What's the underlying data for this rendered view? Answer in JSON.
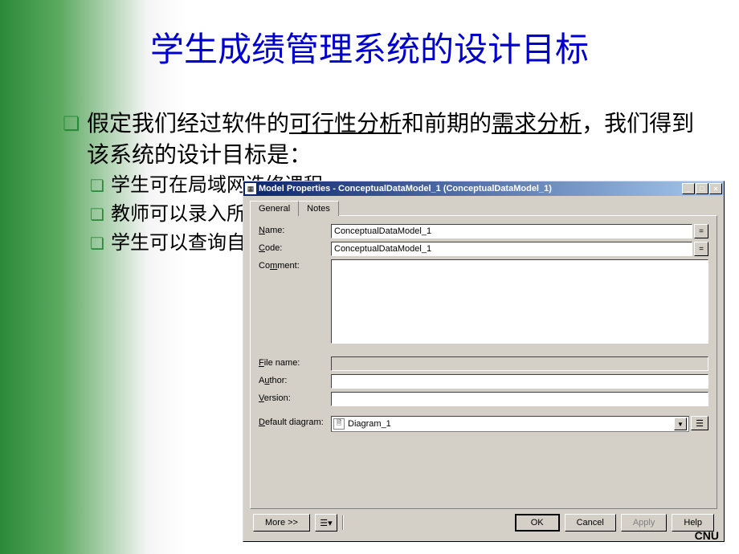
{
  "slide": {
    "title": "学生成绩管理系统的设计目标",
    "bullet1_part1": "假定我们经过软件的",
    "bullet1_underline1": "可行性分析",
    "bullet1_part2": "和前期的",
    "bullet1_underline2": "需求分析",
    "bullet1_part3": "，我们得到该系统的设计目标是：",
    "sub1": "学生可在局域网选修课程",
    "sub2": "教师可以录入所教授课程的学生成绩",
    "sub3": "学生可以查询自己的必修和选修课程的成绩"
  },
  "dialog": {
    "title": "Model Properties - ConceptualDataModel_1 (ConceptualDataModel_1)",
    "tabs": {
      "general": "General",
      "notes": "Notes"
    },
    "labels": {
      "name": "Name:",
      "code": "Code:",
      "comment": "Comment:",
      "filename": "File name:",
      "author": "Author:",
      "version": "Version:",
      "default_diagram": "Default diagram:"
    },
    "values": {
      "name": "ConceptualDataModel_1",
      "code": "ConceptualDataModel_1",
      "comment": "",
      "filename": "",
      "author": "",
      "version": "",
      "default_diagram": "Diagram_1"
    },
    "buttons": {
      "more": "More >>",
      "ok": "OK",
      "cancel": "Cancel",
      "apply": "Apply",
      "help": "Help",
      "eq": "="
    }
  },
  "footer": {
    "cnu": "CNU"
  },
  "icons": {
    "min": "_",
    "max": "□",
    "close": "×",
    "list": "☰▾",
    "dropdown": "▼",
    "doc": "▦",
    "diagram": "🗎",
    "properties": "☰"
  }
}
